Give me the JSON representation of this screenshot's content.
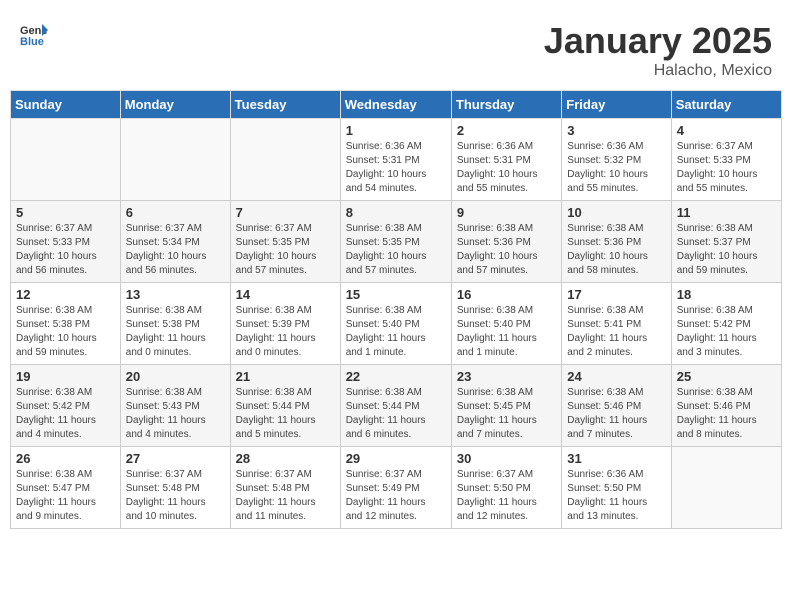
{
  "header": {
    "logo_general": "General",
    "logo_blue": "Blue",
    "title": "January 2025",
    "subtitle": "Halacho, Mexico"
  },
  "days_of_week": [
    "Sunday",
    "Monday",
    "Tuesday",
    "Wednesday",
    "Thursday",
    "Friday",
    "Saturday"
  ],
  "weeks": [
    [
      {
        "day": "",
        "info": ""
      },
      {
        "day": "",
        "info": ""
      },
      {
        "day": "",
        "info": ""
      },
      {
        "day": "1",
        "info": "Sunrise: 6:36 AM\nSunset: 5:31 PM\nDaylight: 10 hours\nand 54 minutes."
      },
      {
        "day": "2",
        "info": "Sunrise: 6:36 AM\nSunset: 5:31 PM\nDaylight: 10 hours\nand 55 minutes."
      },
      {
        "day": "3",
        "info": "Sunrise: 6:36 AM\nSunset: 5:32 PM\nDaylight: 10 hours\nand 55 minutes."
      },
      {
        "day": "4",
        "info": "Sunrise: 6:37 AM\nSunset: 5:33 PM\nDaylight: 10 hours\nand 55 minutes."
      }
    ],
    [
      {
        "day": "5",
        "info": "Sunrise: 6:37 AM\nSunset: 5:33 PM\nDaylight: 10 hours\nand 56 minutes."
      },
      {
        "day": "6",
        "info": "Sunrise: 6:37 AM\nSunset: 5:34 PM\nDaylight: 10 hours\nand 56 minutes."
      },
      {
        "day": "7",
        "info": "Sunrise: 6:37 AM\nSunset: 5:35 PM\nDaylight: 10 hours\nand 57 minutes."
      },
      {
        "day": "8",
        "info": "Sunrise: 6:38 AM\nSunset: 5:35 PM\nDaylight: 10 hours\nand 57 minutes."
      },
      {
        "day": "9",
        "info": "Sunrise: 6:38 AM\nSunset: 5:36 PM\nDaylight: 10 hours\nand 57 minutes."
      },
      {
        "day": "10",
        "info": "Sunrise: 6:38 AM\nSunset: 5:36 PM\nDaylight: 10 hours\nand 58 minutes."
      },
      {
        "day": "11",
        "info": "Sunrise: 6:38 AM\nSunset: 5:37 PM\nDaylight: 10 hours\nand 59 minutes."
      }
    ],
    [
      {
        "day": "12",
        "info": "Sunrise: 6:38 AM\nSunset: 5:38 PM\nDaylight: 10 hours\nand 59 minutes."
      },
      {
        "day": "13",
        "info": "Sunrise: 6:38 AM\nSunset: 5:38 PM\nDaylight: 11 hours\nand 0 minutes."
      },
      {
        "day": "14",
        "info": "Sunrise: 6:38 AM\nSunset: 5:39 PM\nDaylight: 11 hours\nand 0 minutes."
      },
      {
        "day": "15",
        "info": "Sunrise: 6:38 AM\nSunset: 5:40 PM\nDaylight: 11 hours\nand 1 minute."
      },
      {
        "day": "16",
        "info": "Sunrise: 6:38 AM\nSunset: 5:40 PM\nDaylight: 11 hours\nand 1 minute."
      },
      {
        "day": "17",
        "info": "Sunrise: 6:38 AM\nSunset: 5:41 PM\nDaylight: 11 hours\nand 2 minutes."
      },
      {
        "day": "18",
        "info": "Sunrise: 6:38 AM\nSunset: 5:42 PM\nDaylight: 11 hours\nand 3 minutes."
      }
    ],
    [
      {
        "day": "19",
        "info": "Sunrise: 6:38 AM\nSunset: 5:42 PM\nDaylight: 11 hours\nand 4 minutes."
      },
      {
        "day": "20",
        "info": "Sunrise: 6:38 AM\nSunset: 5:43 PM\nDaylight: 11 hours\nand 4 minutes."
      },
      {
        "day": "21",
        "info": "Sunrise: 6:38 AM\nSunset: 5:44 PM\nDaylight: 11 hours\nand 5 minutes."
      },
      {
        "day": "22",
        "info": "Sunrise: 6:38 AM\nSunset: 5:44 PM\nDaylight: 11 hours\nand 6 minutes."
      },
      {
        "day": "23",
        "info": "Sunrise: 6:38 AM\nSunset: 5:45 PM\nDaylight: 11 hours\nand 7 minutes."
      },
      {
        "day": "24",
        "info": "Sunrise: 6:38 AM\nSunset: 5:46 PM\nDaylight: 11 hours\nand 7 minutes."
      },
      {
        "day": "25",
        "info": "Sunrise: 6:38 AM\nSunset: 5:46 PM\nDaylight: 11 hours\nand 8 minutes."
      }
    ],
    [
      {
        "day": "26",
        "info": "Sunrise: 6:38 AM\nSunset: 5:47 PM\nDaylight: 11 hours\nand 9 minutes."
      },
      {
        "day": "27",
        "info": "Sunrise: 6:37 AM\nSunset: 5:48 PM\nDaylight: 11 hours\nand 10 minutes."
      },
      {
        "day": "28",
        "info": "Sunrise: 6:37 AM\nSunset: 5:48 PM\nDaylight: 11 hours\nand 11 minutes."
      },
      {
        "day": "29",
        "info": "Sunrise: 6:37 AM\nSunset: 5:49 PM\nDaylight: 11 hours\nand 12 minutes."
      },
      {
        "day": "30",
        "info": "Sunrise: 6:37 AM\nSunset: 5:50 PM\nDaylight: 11 hours\nand 12 minutes."
      },
      {
        "day": "31",
        "info": "Sunrise: 6:36 AM\nSunset: 5:50 PM\nDaylight: 11 hours\nand 13 minutes."
      },
      {
        "day": "",
        "info": ""
      }
    ]
  ]
}
